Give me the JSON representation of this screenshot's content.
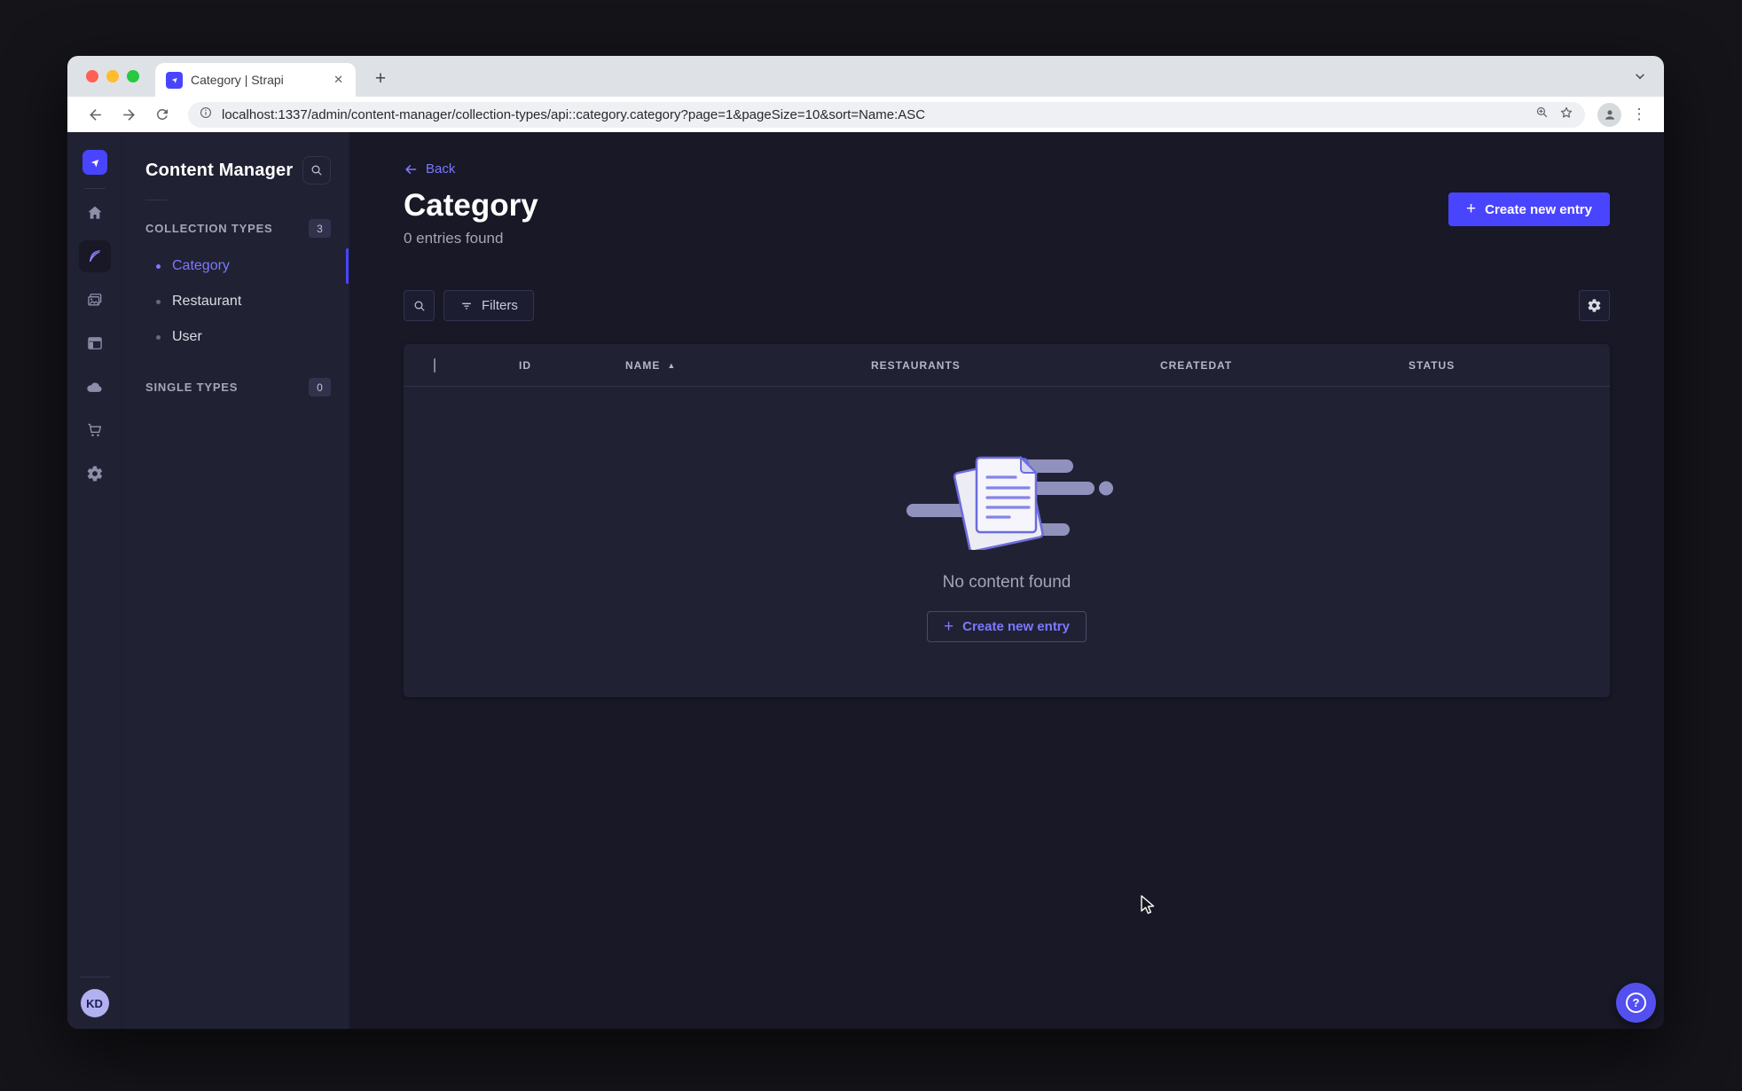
{
  "browser": {
    "tab_title": "Category | Strapi",
    "url": "localhost:1337/admin/content-manager/collection-types/api::category.category?page=1&pageSize=10&sort=Name:ASC",
    "glyphs": {
      "close": "✕",
      "new_tab": "+",
      "menu_dots": "⋮"
    }
  },
  "sidebar": {
    "icons": [
      "strapi-logo",
      "home",
      "content-manager",
      "media-library",
      "content-type-builder",
      "cloud",
      "marketplace",
      "settings"
    ],
    "active_icon": "content-manager",
    "avatar_initials": "KD"
  },
  "subnav": {
    "title": "Content Manager",
    "sections": [
      {
        "label": "COLLECTION TYPES",
        "badge": "3",
        "items": [
          {
            "label": "Category",
            "active": true
          },
          {
            "label": "Restaurant",
            "active": false
          },
          {
            "label": "User",
            "active": false
          }
        ]
      },
      {
        "label": "SINGLE TYPES",
        "badge": "0",
        "items": []
      }
    ]
  },
  "main": {
    "back_label": "Back",
    "title": "Category",
    "subtitle": "0 entries found",
    "create_button_label": "Create new entry",
    "filters_label": "Filters",
    "plus_glyph": "+",
    "table": {
      "columns": [
        "ID",
        "NAME",
        "RESTAURANTS",
        "CREATEDAT",
        "STATUS"
      ],
      "sorted_column": "NAME",
      "sort_direction": "ASC",
      "sort_glyph": "▲"
    },
    "empty_state": {
      "message": "No content found",
      "cta_label": "Create new entry"
    },
    "help_glyph": "?"
  },
  "colors": {
    "primary": "#4945ff",
    "primary_light": "#7b79ff",
    "page_bg": "#181826",
    "panel_bg": "#212134",
    "border": "#32324d",
    "text_muted": "#a5a5ba"
  }
}
